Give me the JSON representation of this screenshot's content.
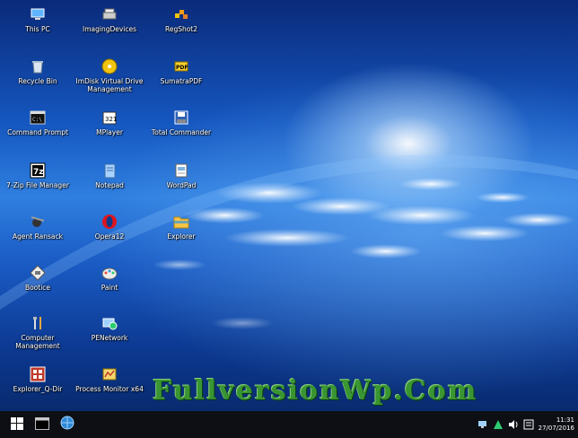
{
  "desktop": {
    "icons": [
      {
        "label": "This PC",
        "icon": "this-pc-icon"
      },
      {
        "label": "ImagingDevices",
        "icon": "imaging-devices-icon"
      },
      {
        "label": "RegShot2",
        "icon": "regshot-icon"
      },
      {
        "label": "Recycle Bin",
        "icon": "recycle-bin-icon"
      },
      {
        "label": "ImDisk Virtual Drive Management",
        "icon": "imdisk-icon"
      },
      {
        "label": "SumatraPDF",
        "icon": "sumatra-pdf-icon"
      },
      {
        "label": "Command Prompt",
        "icon": "command-prompt-icon"
      },
      {
        "label": "MPlayer",
        "icon": "mplayer-icon"
      },
      {
        "label": "Total Commander",
        "icon": "total-commander-icon"
      },
      {
        "label": "7-Zip File Manager",
        "icon": "seven-zip-icon"
      },
      {
        "label": "Notepad",
        "icon": "notepad-icon"
      },
      {
        "label": "WordPad",
        "icon": "wordpad-icon"
      },
      {
        "label": "Agent Ransack",
        "icon": "agent-ransack-icon"
      },
      {
        "label": "Opera12",
        "icon": "opera-icon"
      },
      {
        "label": "Explorer",
        "icon": "folder-icon"
      },
      {
        "label": "Bootice",
        "icon": "bootice-icon"
      },
      {
        "label": "Paint",
        "icon": "paint-icon"
      },
      {
        "label": "Computer Management",
        "icon": "computer-management-icon"
      },
      {
        "label": "PENetwork",
        "icon": "pe-network-icon"
      },
      {
        "label": "Explorer_Q-Dir",
        "icon": "q-dir-icon"
      },
      {
        "label": "Process Monitor x64",
        "icon": "process-monitor-icon"
      }
    ]
  },
  "watermark": "FullversionWp.Com",
  "taskbar": {
    "start_icon": "windows-start-icon",
    "pinned": [
      "command-prompt-icon",
      "network-globe-icon"
    ],
    "tray_icons": [
      "network-tray-icon",
      "action-center-icon",
      "volume-icon",
      "notification-icon"
    ],
    "time": "11:31",
    "date": "27/07/2016"
  },
  "colors": {
    "accent": "#1a5bc4",
    "taskbar": "#0d0f14",
    "watermark": "#3fa12a"
  }
}
